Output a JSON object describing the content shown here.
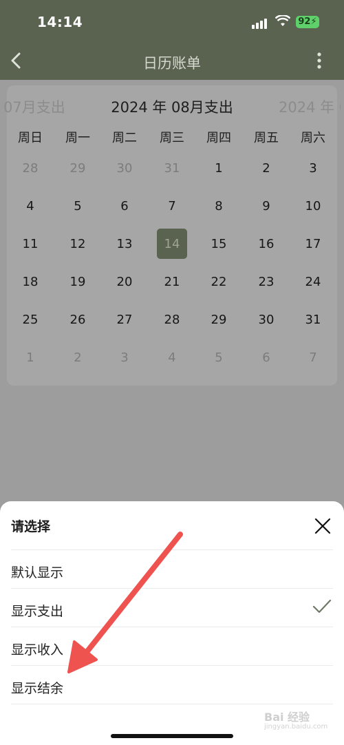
{
  "status": {
    "time": "14:14",
    "battery": "92"
  },
  "nav": {
    "title": "日历账单"
  },
  "calendar": {
    "prev_month": "07月支出",
    "current_month": "2024 年 08月支出",
    "next_month": "2024 年 0",
    "weekdays": [
      "周日",
      "周一",
      "周二",
      "周三",
      "周四",
      "周五",
      "周六"
    ],
    "weeks": [
      [
        "28",
        "29",
        "30",
        "31",
        "1",
        "2",
        "3"
      ],
      [
        "4",
        "5",
        "6",
        "7",
        "8",
        "9",
        "10"
      ],
      [
        "11",
        "12",
        "13",
        "14",
        "15",
        "16",
        "17"
      ],
      [
        "18",
        "19",
        "20",
        "21",
        "22",
        "23",
        "24"
      ],
      [
        "25",
        "26",
        "27",
        "28",
        "29",
        "30",
        "31"
      ],
      [
        "1",
        "2",
        "3",
        "4",
        "5",
        "6",
        "7"
      ]
    ],
    "selected_day": "14"
  },
  "sheet": {
    "title": "请选择",
    "options": [
      "默认显示",
      "显示支出",
      "显示收入",
      "显示结余"
    ],
    "selected_option": "显示支出"
  },
  "watermark": {
    "brand": "Bai 经验",
    "url": "jingyan.baidu.com"
  },
  "colors": {
    "theme": "#5a6250",
    "arrow": "#ef5350",
    "battery": "#5fd16b"
  }
}
